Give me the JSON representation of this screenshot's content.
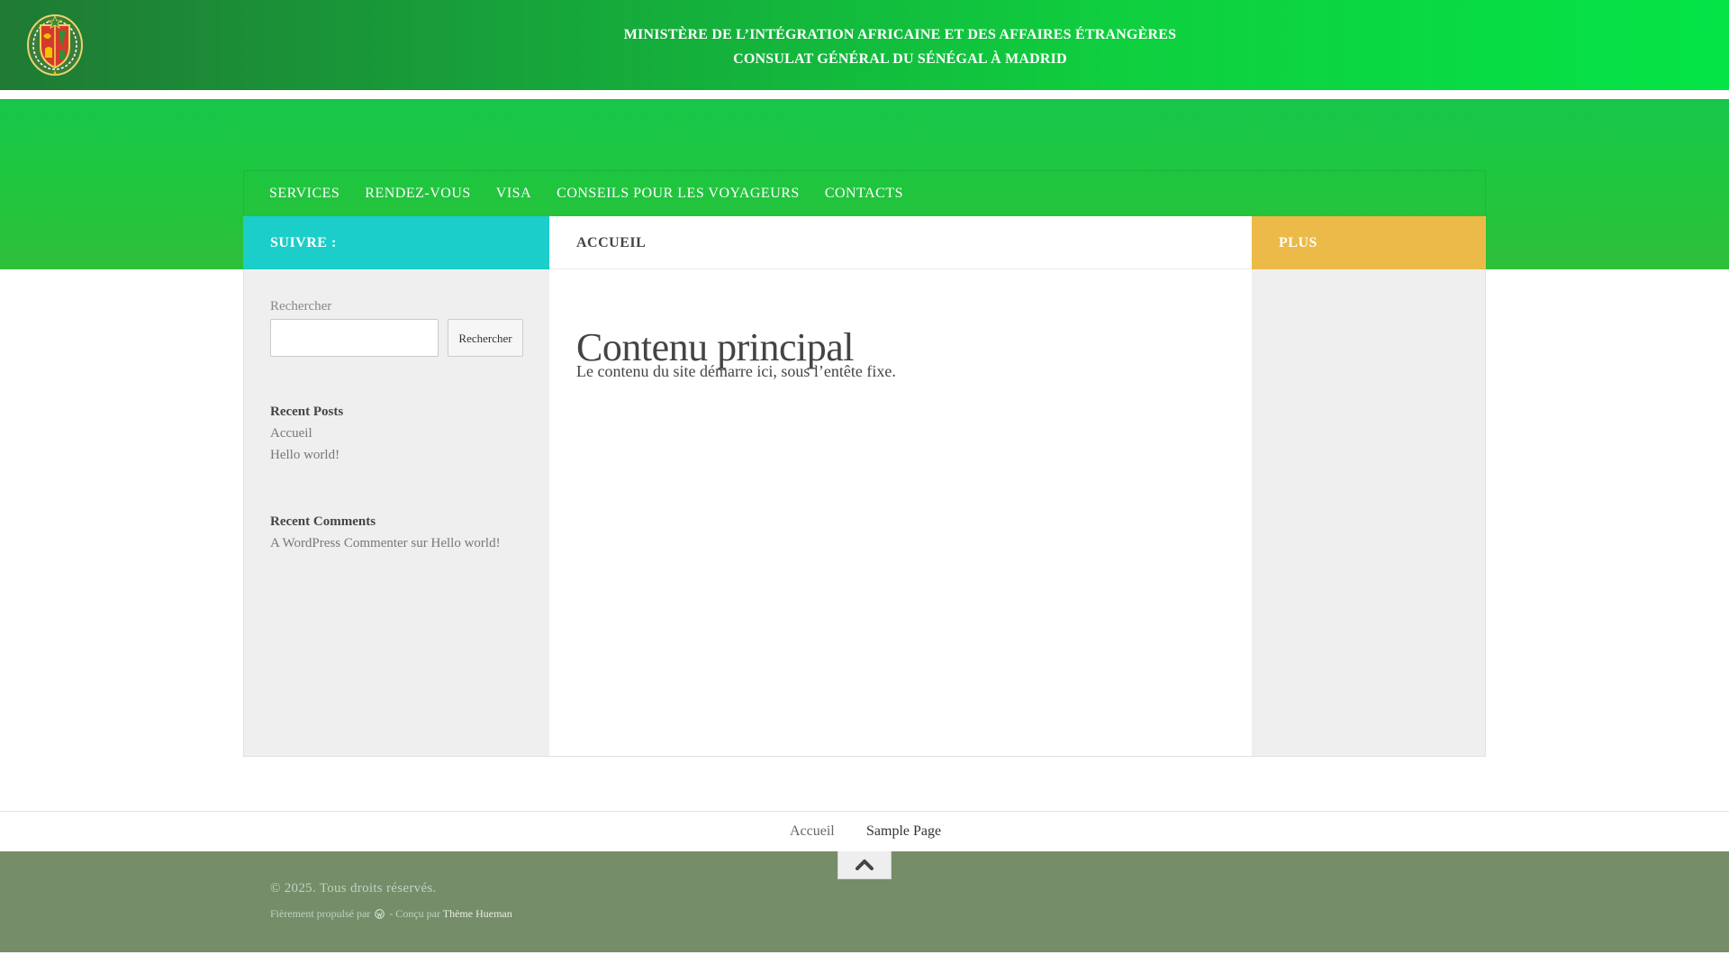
{
  "header": {
    "logo_icon": "senegal-coat-of-arms-icon",
    "line1": "MINISTÈRE DE L’INTÉGRATION AFRICAINE ET DES AFFAIRES ÉTRANGÈRES",
    "line2": "CONSULAT GÉNÉRAL DU SÉNÉGAL À MADRID"
  },
  "nav": {
    "items": [
      "SERVICES",
      "RENDEZ-VOUS",
      "VISA",
      "CONSEILS POUR LES VOYAGEURS",
      "CONTACTS"
    ]
  },
  "columns": {
    "left_title": "SUIVRE :",
    "main_title": "ACCUEIL",
    "right_title": "PLUS"
  },
  "sidebar": {
    "search_label": "Rechercher",
    "search_value": "",
    "search_button": "Rechercher",
    "recent_posts_title": "Recent Posts",
    "recent_posts": [
      "Accueil",
      "Hello world!"
    ],
    "recent_comments_title": "Recent Comments",
    "recent_comment": "A WordPress Commenter sur Hello world!"
  },
  "main": {
    "heading": "Contenu principal",
    "text": "Le contenu du site démarre ici, sous l’entête fixe."
  },
  "footer_nav": {
    "links": [
      "Accueil",
      "Sample Page"
    ]
  },
  "footer": {
    "back_to_top_icon": "chevron-up-icon",
    "copyright": "© 2025. Tous droits réservés.",
    "powered_prefix": "Fièrement propulsé par",
    "wordpress_icon": "wordpress-icon",
    "designed_by": "- Conçu par",
    "theme_link": "Thème Hueman"
  },
  "colors": {
    "header_gradient_start": "#1f7a34",
    "header_gradient_end": "#04e447",
    "band_green": "#1ec63f",
    "left_header": "#1bcec9",
    "right_header": "#ecba48",
    "footer_bg": "#758d69"
  }
}
